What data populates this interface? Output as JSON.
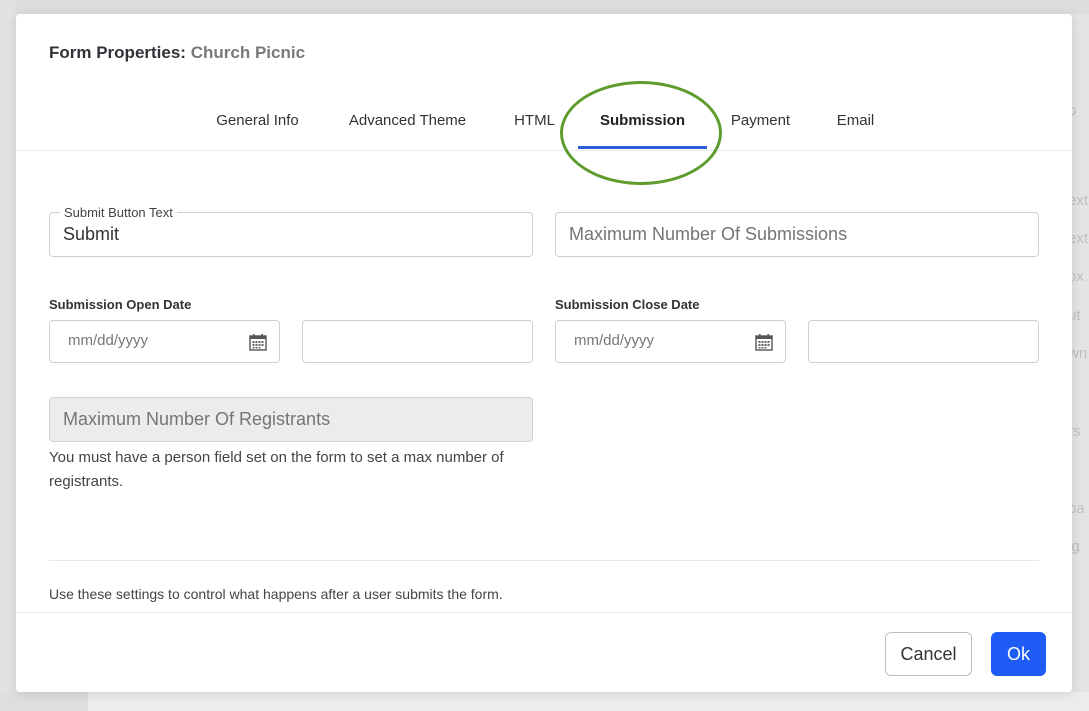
{
  "modal": {
    "title_prefix": "Form Properties:",
    "form_name": "Church Picnic"
  },
  "tabs": [
    {
      "label": "General Info",
      "active": false
    },
    {
      "label": "Advanced Theme",
      "active": false
    },
    {
      "label": "HTML",
      "active": false
    },
    {
      "label": "Submission",
      "active": true
    },
    {
      "label": "Payment",
      "active": false
    },
    {
      "label": "Email",
      "active": false
    }
  ],
  "submission": {
    "submit_button_text_label": "Submit Button Text",
    "submit_button_text_value": "Submit",
    "max_submissions_placeholder": "Maximum Number Of Submissions",
    "open_date_label": "Submission Open Date",
    "open_date_placeholder": "mm/dd/yyyy",
    "close_date_label": "Submission Close Date",
    "close_date_placeholder": "mm/dd/yyyy",
    "max_registrants_placeholder": "Maximum Number Of Registrants",
    "max_registrants_help": "You must have a person field set on the form to set a max number of registrants.",
    "after_submit_note": "Use these settings to control what happens after a user submits the form."
  },
  "footer": {
    "cancel_label": "Cancel",
    "ok_label": "Ok"
  },
  "colors": {
    "accent": "#1f5cf5",
    "tab_underline": "#2c5fd8",
    "highlight": "#5e9c2e"
  },
  "background_fragments": [
    "o",
    "ext",
    "ext",
    "ox",
    "ut",
    "wn",
    "rs",
    "oa",
    "ig"
  ]
}
